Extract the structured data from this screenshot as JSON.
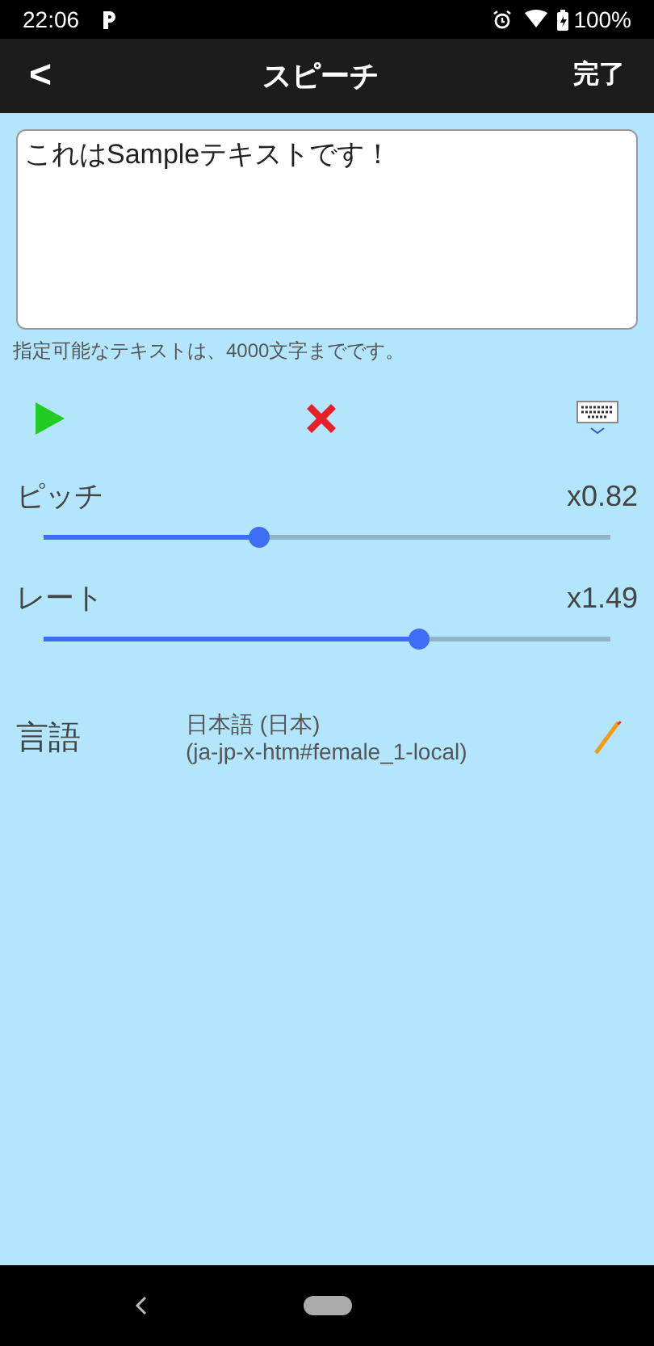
{
  "status_bar": {
    "time": "22:06",
    "battery": "100%"
  },
  "app_bar": {
    "back": "<",
    "title": "スピーチ",
    "done": "完了"
  },
  "text_field": {
    "value": "これはSampleテキストです！"
  },
  "hint": "指定可能なテキストは、4000文字までです。",
  "sliders": [
    {
      "label": "ピッチ",
      "reading": "x0.82",
      "level": 0.38
    },
    {
      "label": "レート",
      "reading": "x1.49",
      "level": 0.66
    }
  ],
  "language": {
    "label": "言語",
    "name": "日本語 (日本)",
    "voice": "(ja-jp-x-htm#female_1-local)"
  }
}
